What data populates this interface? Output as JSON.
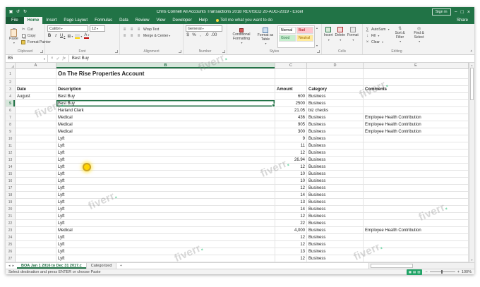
{
  "title_bar": {
    "title": "Chris Connell All Accounts Transactions 2018 REVISED 20-AUG-2019 - Excel",
    "sign_in": "Sign in"
  },
  "ribbon_tabs": {
    "file": "File",
    "tabs": [
      "Home",
      "Insert",
      "Page Layout",
      "Formulas",
      "Data",
      "Review",
      "View",
      "Developer",
      "Help"
    ],
    "active": "Home",
    "tell_me": "Tell me what you want to do",
    "share": "Share"
  },
  "ribbon": {
    "clipboard": {
      "label": "Clipboard",
      "paste": "Paste",
      "cut": "Cut",
      "copy": "Copy",
      "format_painter": "Format Painter"
    },
    "font": {
      "label": "Font",
      "family": "Calibri",
      "size": "12",
      "bold": "B",
      "italic": "I",
      "underline": "U",
      "color_letter": "A"
    },
    "alignment": {
      "label": "Alignment",
      "wrap": "Wrap Text",
      "merge": "Merge & Center"
    },
    "number": {
      "label": "Number",
      "format": "General",
      "symbols": [
        "$",
        "%",
        ",",
        ".0",
        ".00"
      ]
    },
    "styles": {
      "label": "Styles",
      "conditional": "Conditional Formatting",
      "format_table": "Format as Table",
      "cell_styles": [
        "Normal",
        "Bad",
        "Good",
        "Neutral"
      ]
    },
    "cells": {
      "label": "Cells",
      "buttons": [
        "Insert",
        "Delete",
        "Format"
      ]
    },
    "editing": {
      "label": "Editing",
      "autosum": "AutoSum",
      "buttons": [
        "Fill",
        "Clear"
      ],
      "sort": "Sort & Filter",
      "find": "Find & Select"
    }
  },
  "icons": {
    "save": "▣",
    "undo": "↺",
    "redo": "↻",
    "minimize": "−",
    "maximize": "□",
    "close": "×",
    "cut": "✂",
    "sigma": "∑",
    "borders": "⊞",
    "align": "≡",
    "fill_down": "↓",
    "clear": "×",
    "sort": "⇅",
    "find": "◎",
    "tab_left": "◂",
    "tab_right": "▸",
    "scroll_up": "▴",
    "scroll_down": "▾",
    "check": "✓",
    "cancel": "×",
    "fx": "fx",
    "views": [
      "▦",
      "▤",
      "▥"
    ],
    "zoom_minus": "−",
    "zoom_plus": "+"
  },
  "formula_bar": {
    "name_box": "B5",
    "value": "Best Buy"
  },
  "grid": {
    "columns": [
      "A",
      "B",
      "C",
      "D",
      "E"
    ],
    "active_column": "B",
    "active_row": 5,
    "title_row": {
      "row": 1,
      "text": "On The Rise Properties Account"
    },
    "header_row": {
      "row": 3,
      "date": "Date",
      "description": "Description",
      "amount": "Amount",
      "category": "Category",
      "comments": "Comments"
    },
    "rows": [
      {
        "row": 4,
        "date": "August",
        "description": "Best Buy",
        "amount": "600",
        "category": "Business",
        "comment": ""
      },
      {
        "row": 5,
        "date": "",
        "description": "Best Buy",
        "amount": "2500",
        "category": "Business",
        "comment": "",
        "selected": true
      },
      {
        "row": 6,
        "date": "",
        "description": "Harland Clark",
        "amount": "21.05",
        "category": "biz checks",
        "comment": ""
      },
      {
        "row": 7,
        "date": "",
        "description": "Medical",
        "amount": "436",
        "category": "Business",
        "comment": "Employee Health Contribution"
      },
      {
        "row": 8,
        "date": "",
        "description": "Medical",
        "amount": "905",
        "category": "Business",
        "comment": "Employee Health Contribution"
      },
      {
        "row": 9,
        "date": "",
        "description": "Medical",
        "amount": "300",
        "category": "Business",
        "comment": "Employee Health Contribution"
      },
      {
        "row": 10,
        "date": "",
        "description": "Lyft",
        "amount": "9",
        "category": "Business",
        "comment": ""
      },
      {
        "row": 11,
        "date": "",
        "description": "Lyft",
        "amount": "11",
        "category": "Business",
        "comment": ""
      },
      {
        "row": 12,
        "date": "",
        "description": "Lyft",
        "amount": "12",
        "category": "Business",
        "comment": ""
      },
      {
        "row": 13,
        "date": "",
        "description": "Lyft",
        "amount": "26.94",
        "category": "Business",
        "comment": ""
      },
      {
        "row": 14,
        "date": "",
        "description": "Lyft",
        "amount": "12",
        "category": "Business",
        "comment": ""
      },
      {
        "row": 15,
        "date": "",
        "description": "Lyft",
        "amount": "10",
        "category": "Business",
        "comment": ""
      },
      {
        "row": 16,
        "date": "",
        "description": "Lyft",
        "amount": "10",
        "category": "Business",
        "comment": ""
      },
      {
        "row": 17,
        "date": "",
        "description": "Lyft",
        "amount": "12",
        "category": "Business",
        "comment": ""
      },
      {
        "row": 18,
        "date": "",
        "description": "Lyft",
        "amount": "14",
        "category": "Business",
        "comment": ""
      },
      {
        "row": 19,
        "date": "",
        "description": "Lyft",
        "amount": "13",
        "category": "Business",
        "comment": ""
      },
      {
        "row": 20,
        "date": "",
        "description": "Lyft",
        "amount": "14",
        "category": "Business",
        "comment": ""
      },
      {
        "row": 21,
        "date": "",
        "description": "Lyft",
        "amount": "12",
        "category": "Business",
        "comment": ""
      },
      {
        "row": 22,
        "date": "",
        "description": "Lyft",
        "amount": "22",
        "category": "Business",
        "comment": ""
      },
      {
        "row": 23,
        "date": "",
        "description": "Medical",
        "amount": "4,000",
        "category": "Business",
        "comment": "Employee Health Contribution"
      },
      {
        "row": 24,
        "date": "",
        "description": "Lyft",
        "amount": "12",
        "category": "Business",
        "comment": ""
      },
      {
        "row": 25,
        "date": "",
        "description": "Lyft",
        "amount": "12",
        "category": "Business",
        "comment": ""
      },
      {
        "row": 26,
        "date": "",
        "description": "Lyft",
        "amount": "13",
        "category": "Business",
        "comment": ""
      },
      {
        "row": 27,
        "date": "",
        "description": "Lyft",
        "amount": "12",
        "category": "Business",
        "comment": ""
      }
    ]
  },
  "sheet_tabs": {
    "tabs": [
      {
        "label": "BOA Jan 1 2016 to Dec 31 2017.c",
        "active": true
      },
      {
        "label": "Categorized",
        "active": false
      }
    ]
  },
  "status_bar": {
    "message": "Select destination and press ENTER or choose Paste",
    "zoom": "100%"
  },
  "watermark": {
    "text": "fiverr",
    "dot": "."
  }
}
